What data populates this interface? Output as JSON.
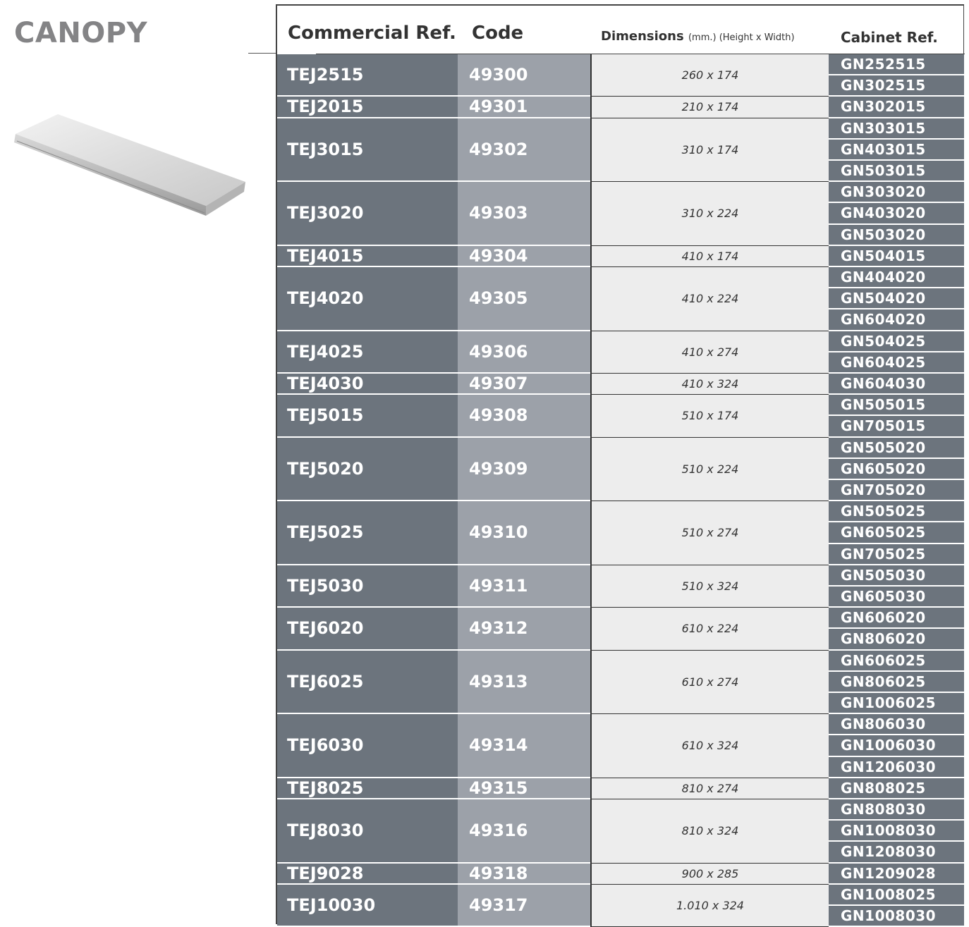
{
  "title": "CANOPY",
  "headers": {
    "commercial_ref": "Commercial Ref.",
    "code": "Code",
    "dimensions": "Dimensions",
    "dimensions_unit": "(mm.) (Height x Width)",
    "cabinet_ref": "Cabinet Ref."
  },
  "rows": [
    {
      "ref": "TEJ2515",
      "code": "49300",
      "dim": "260 x 174",
      "cabinets": [
        "GN252515",
        "GN302515"
      ]
    },
    {
      "ref": "TEJ2015",
      "code": "49301",
      "dim": "210 x 174",
      "cabinets": [
        "GN302015"
      ]
    },
    {
      "ref": "TEJ3015",
      "code": "49302",
      "dim": "310 x 174",
      "cabinets": [
        "GN303015",
        "GN403015",
        "GN503015"
      ]
    },
    {
      "ref": "TEJ3020",
      "code": "49303",
      "dim": "310 x 224",
      "cabinets": [
        "GN303020",
        "GN403020",
        "GN503020"
      ]
    },
    {
      "ref": "TEJ4015",
      "code": "49304",
      "dim": "410 x 174",
      "cabinets": [
        "GN504015"
      ]
    },
    {
      "ref": "TEJ4020",
      "code": "49305",
      "dim": "410 x 224",
      "cabinets": [
        "GN404020",
        "GN504020",
        "GN604020"
      ]
    },
    {
      "ref": "TEJ4025",
      "code": "49306",
      "dim": "410 x 274",
      "cabinets": [
        "GN504025",
        "GN604025"
      ]
    },
    {
      "ref": "TEJ4030",
      "code": "49307",
      "dim": "410 x 324",
      "cabinets": [
        "GN604030"
      ]
    },
    {
      "ref": "TEJ5015",
      "code": "49308",
      "dim": "510 x 174",
      "cabinets": [
        "GN505015",
        "GN705015"
      ]
    },
    {
      "ref": "TEJ5020",
      "code": "49309",
      "dim": "510 x 224",
      "cabinets": [
        "GN505020",
        "GN605020",
        "GN705020"
      ]
    },
    {
      "ref": "TEJ5025",
      "code": "49310",
      "dim": "510 x 274",
      "cabinets": [
        "GN505025",
        "GN605025",
        "GN705025"
      ]
    },
    {
      "ref": "TEJ5030",
      "code": "49311",
      "dim": "510 x 324",
      "cabinets": [
        "GN505030",
        "GN605030"
      ]
    },
    {
      "ref": "TEJ6020",
      "code": "49312",
      "dim": "610 x 224",
      "cabinets": [
        "GN606020",
        "GN806020"
      ]
    },
    {
      "ref": "TEJ6025",
      "code": "49313",
      "dim": "610 x 274",
      "cabinets": [
        "GN606025",
        "GN806025",
        "GN1006025"
      ]
    },
    {
      "ref": "TEJ6030",
      "code": "49314",
      "dim": "610 x 324",
      "cabinets": [
        "GN806030",
        "GN1006030",
        "GN1206030"
      ]
    },
    {
      "ref": "TEJ8025",
      "code": "49315",
      "dim": "810 x 274",
      "cabinets": [
        "GN808025"
      ]
    },
    {
      "ref": "TEJ8030",
      "code": "49316",
      "dim": "810 x 324",
      "cabinets": [
        "GN808030",
        "GN1008030",
        "GN1208030"
      ]
    },
    {
      "ref": "TEJ9028",
      "code": "49318",
      "dim": "900 x 285",
      "cabinets": [
        "GN1209028"
      ]
    },
    {
      "ref": "TEJ10030",
      "code": "49317",
      "dim": "1.010 x 324",
      "cabinets": [
        "GN1008025",
        "GN1008030"
      ]
    }
  ],
  "colors": {
    "ref_column": "#6c747d",
    "code_column": "#9ca1a9",
    "dimension_column": "#ededed",
    "title": "#848486"
  }
}
